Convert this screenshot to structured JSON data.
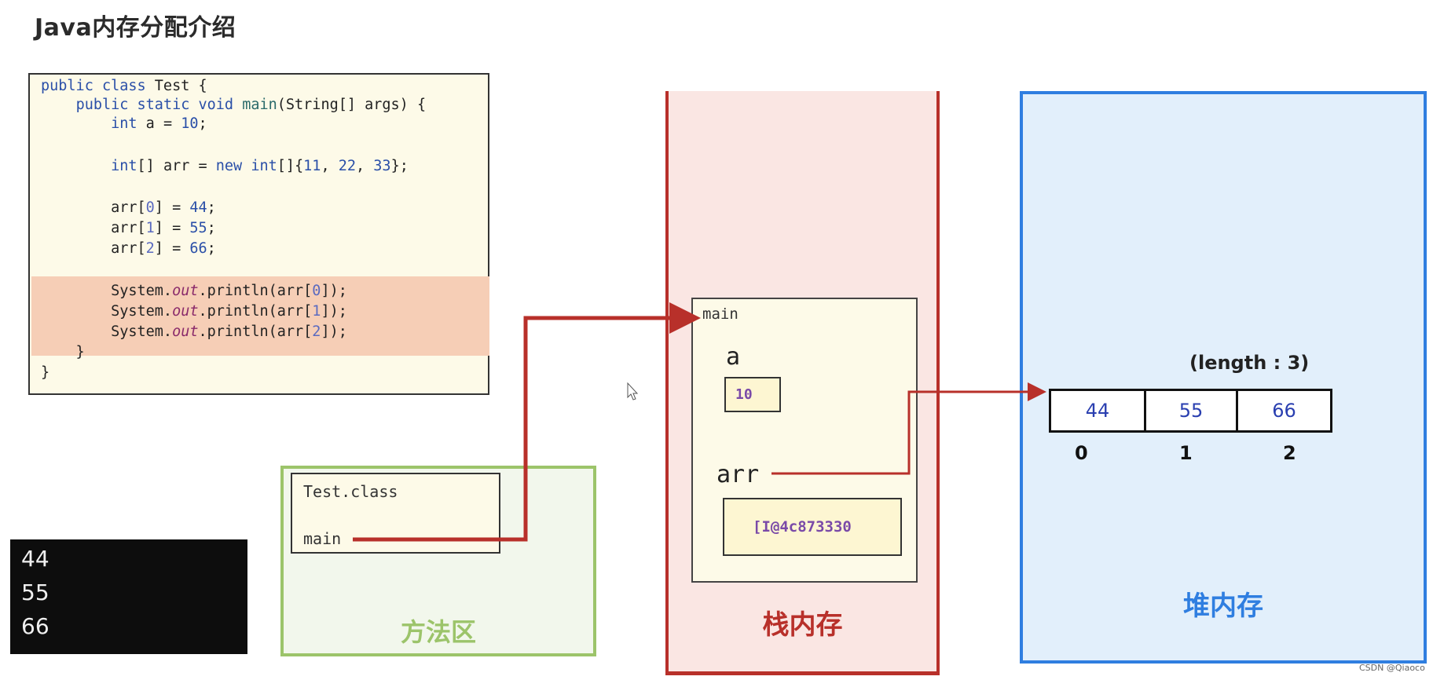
{
  "title": "Java内存分配介绍",
  "code": {
    "lines": [
      "public class Test {",
      "    public static void main(String[] args) {",
      "        int a = 10;",
      "",
      "        int[] arr = new int[]{11, 22, 33};",
      "",
      "        arr[0] = 44;",
      "        arr[1] = 55;",
      "        arr[2] = 66;",
      "",
      "        System.out.println(arr[0]);",
      "        System.out.println(arr[1]);",
      "        System.out.println(arr[2]);",
      "    }",
      "}"
    ],
    "highlighted_lines": [
      10,
      11,
      12
    ]
  },
  "console": {
    "output": [
      "44",
      "55",
      "66"
    ]
  },
  "method_area": {
    "label": "方法区",
    "class_name": "Test.class",
    "method": "main",
    "color": "#9cc46a"
  },
  "stack": {
    "label": "栈内存",
    "frame_name": "main",
    "var_a": {
      "name": "a",
      "value": "10"
    },
    "var_arr": {
      "name": "arr",
      "value": "[I@4c873330"
    },
    "color": "#b8302a"
  },
  "heap": {
    "label": "堆内存",
    "length_label": "(length : 3)",
    "array_values": [
      "44",
      "55",
      "66"
    ],
    "indices": [
      "0",
      "1",
      "2"
    ],
    "color": "#2f7ee0"
  },
  "watermark": "CSDN @Qiaoco"
}
